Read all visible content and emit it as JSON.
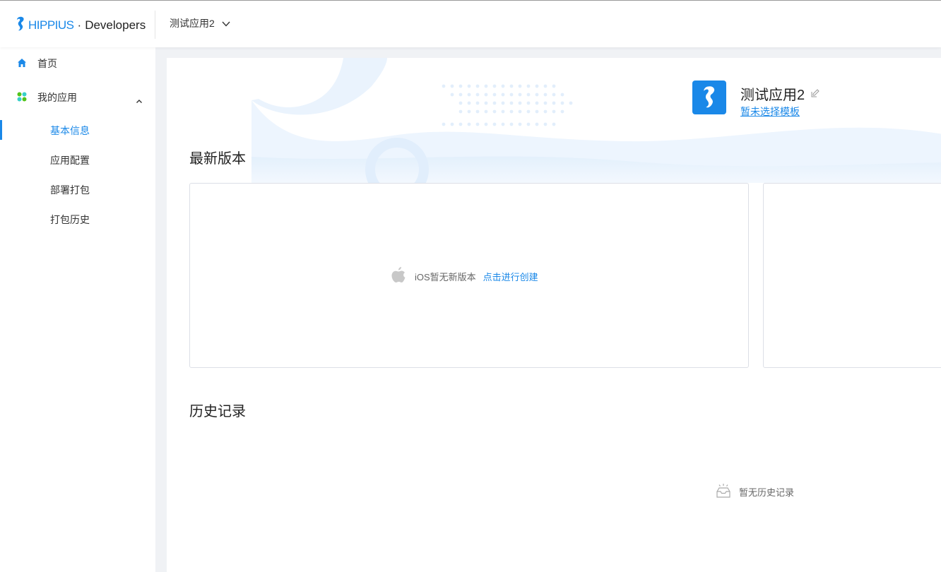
{
  "header": {
    "brand": "HIPPIUS",
    "separator": "·",
    "subtitle": "Developers",
    "current_app": "测试应用2"
  },
  "sidebar": {
    "home_label": "首页",
    "my_apps_label": "我的应用",
    "sub_items": [
      "基本信息",
      "应用配置",
      "部署打包",
      "打包历史"
    ],
    "active_index": 0
  },
  "app": {
    "name": "测试应用2",
    "template_link": "暂未选择模板"
  },
  "latest": {
    "title": "最新版本",
    "ios_empty": "iOS暂无新版本",
    "ios_create": "点击进行创建"
  },
  "history": {
    "title": "历史记录",
    "empty": "暂无历史记录"
  },
  "colors": {
    "accent": "#1a88e8",
    "page_bg": "#f0f2f5",
    "border": "#dcdfe6"
  }
}
